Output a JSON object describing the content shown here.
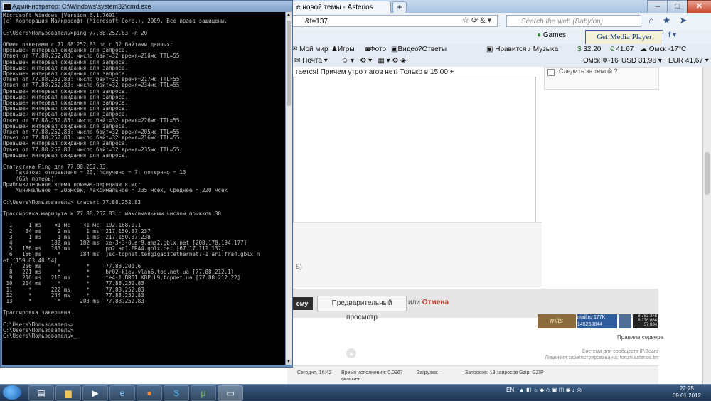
{
  "browser": {
    "tab_title": "е новой темы - Asterios",
    "url_fragment": "&f=137",
    "search_placeholder": "Search the web (Babylon)",
    "games_label": "Games",
    "media_plugin_label": "Get Media Player Plugin",
    "facebook_label": "f",
    "toolbar3": {
      "moi_mir": "Мой мир",
      "igry": "Игры",
      "foto": "Фото",
      "video": "Видео",
      "otvety": "Ответы",
      "nravitsya": "Нравится",
      "muzyka": "Музыка",
      "stock1": "32.20",
      "stock2": "41.67",
      "weather_city": "Омск",
      "weather_temp": "-17°C"
    },
    "toolbar4": {
      "pochta": "Почта",
      "omsk_label": "Омск",
      "omsk_temp": "-16",
      "usd": "USD 31,96",
      "eur": "EUR 41,67"
    },
    "post_text": "гается! Причем утро лагов нет! Только в 15:00 +",
    "follow_label": "Следить за темой ?",
    "mb_label": "Б)",
    "submit_label": "ему",
    "preview_label": "Предварительный просмотр",
    "or_label": "или",
    "cancel_label": "Отмена",
    "badge1": "mits",
    "badge2_line1": "mail.ru 177K",
    "badge2_line2": "145250844  10678",
    "badge4": "8 783 378\n8 276 864\n37 884",
    "server_rules": "Правила сервера",
    "credits_line1": "Система для сообществ IP.Board",
    "credits_line2": "Лицензия зарегистрирована на: forum.asterios.tm",
    "footer": {
      "today": "Сегодня, 16:42",
      "exec_label": "Время исполнения: 0.0967",
      "load_label": "Загрузка: –",
      "queries_label": "Запросов: 13 запросов",
      "gzip_label": "Gzip: GZIP",
      "enabled_label": "включен"
    }
  },
  "cmd": {
    "title": "Администратор: C:\\Windows\\system32\\cmd.exe",
    "text": "Microsoft Windows [Version 6.1.7601]\n(c) Корпорация Майкрософт (Microsoft Corp.), 2009. Все права защищены.\n\nC:\\Users\\Пользователь>ping 77.88.252.83 -n 20\n\nОбмен пакетами с 77.88.252.83 по с 32 байтами данных:\nПревышен интервал ожидания для запроса.\nОтвет от 77.88.252.83: число байт=32 время=210мс TTL=55\nПревышен интервал ожидания для запроса.\nПревышен интервал ожидания для запроса.\nПревышен интервал ожидания для запроса.\nОтвет от 77.88.252.83: число байт=32 время=217мс TTL=55\nОтвет от 77.88.252.83: число байт=32 время=234мс TTL=55\nПревышен интервал ожидания для запроса.\nПревышен интервал ожидания для запроса.\nПревышен интервал ожидания для запроса.\nПревышен интервал ожидания для запроса.\nПревышен интервал ожидания для запроса.\nОтвет от 77.88.252.83: число байт=32 время=226мс TTL=55\nПревышен интервал ожидания для запроса.\nОтвет от 77.88.252.83: число байт=32 время=205мс TTL=55\nОтвет от 77.88.252.83: число байт=32 время=216мс TTL=55\nПревышен интервал ожидания для запроса.\nОтвет от 77.88.252.83: число байт=32 время=235мс TTL=55\nПревышен интервал ожидания для запроса.\n\nСтатистика Ping для 77.88.252.83:\n    Пакетов: отправлено = 20, получено = 7, потеряно = 13\n    (65% потерь)\nПриблизительное время приема-передачи в мс:\n    Минимальное = 205мсек, Максимальное = 235 мсек, Среднее = 220 мсек\n\nC:\\Users\\Пользователь> tracert 77.88.252.83\n\nТрассировка маршрута к 77.88.252.83 с максимальным числом прыжков 30\n\n  1     1 ms    <1 мс    <1 мс  192.168.0.1\n  2    34 ms     2 ms     1 ms  217.150.37.237\n  3     1 ms     1 ms     1 ms  217.150.37.238\n  4     *      182 ms   182 ms  xe-3-3-0.ar9.ams2.gblx.net [208.178.194.177]\n  5   186 ms   183 ms     *     po2.ar1.FRA4.gblx.net [67.17.111.137]\n  6   186 ms     *      184 ms  jsc-topnet.tengigabitethernet7-1.ar1.fra4.gblx.n\net [159.63.48.54]\n  7   236 ms     *        *     77.88.201.6\n  8   221 ms     *        *     br02-kiev-vlan6.top.net.ua [77.88.212.1]\n  9   216 ms   218 ms     *     te4-1.BR01.KBP.L9.topnet.ua [77.88.212.22]\n 10   214 ms     *        *     77.88.252.83\n 11     *      222 ms     *     77.88.252.83\n 12     *      244 ms     *     77.88.252.83\n 13     *        *      203 ms  77.88.252.83\n\nТрассировка завершена.\n\nC:\\Users\\Пользователь>\nC:\\Users\\Пользователь>\nC:\\Users\\Пользователь>_"
  },
  "taskbar": {
    "language": "EN",
    "time": "22:25",
    "date": "09.01.2012"
  },
  "colors": {
    "accent": "#3b5f86",
    "cancel": "#c03a2b",
    "cmd_bg": "#000000",
    "cmd_fg": "#c0c0c0"
  }
}
